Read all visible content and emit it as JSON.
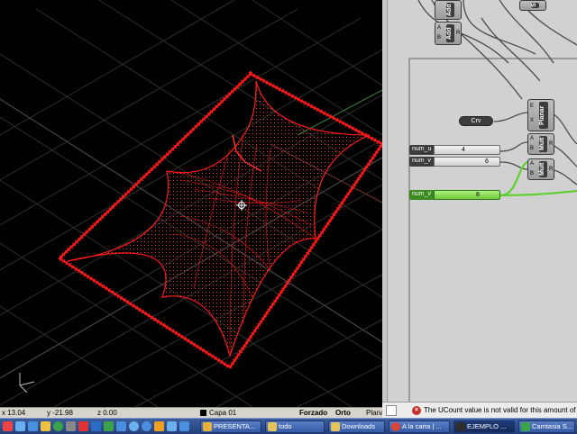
{
  "statusbar": {
    "x": "x 13.04",
    "y": "y -21.98",
    "z": "z 0.00",
    "layer": "Capa 01",
    "snap": "Forzado",
    "ortho": "Orto",
    "planar": "Planar"
  },
  "grasshopper": {
    "nodes": {
      "add_top": "Add",
      "add_mid": "Add",
      "s_top": "S",
      "planar": "Planar",
      "mult_1": "Mult",
      "mult_2": "Mult"
    },
    "ports": {
      "a": "A",
      "b": "B",
      "r": "R",
      "e": "E",
      "x": "X",
      "y": "Y"
    },
    "crv_label": "Crv",
    "sliders": [
      {
        "name": "num_u",
        "value": "4"
      },
      {
        "name": "num_v",
        "value": "6"
      },
      {
        "name": "num_v",
        "value": "8"
      }
    ],
    "message": "The UCount value is not valid for this amount of po"
  },
  "taskbar": {
    "items": [
      {
        "label": "PRESENTA...",
        "color": "#e6b33a"
      },
      {
        "label": "todo",
        "color": "#e6c45a"
      },
      {
        "label": "Downloads",
        "color": "#e6c45a"
      },
      {
        "label": "A la carta | ...",
        "color": "#dd4433"
      },
      {
        "label": "EJEMPLO ...",
        "color": "#2d2d2d"
      },
      {
        "label": "Camtasia S...",
        "color": "#3aa24a"
      }
    ]
  },
  "colors": {
    "mesh": "#ff1a1a",
    "grid": "#3a3a3a",
    "gh_bg": "#d1d1d1",
    "taskbar": "#2c4a88"
  }
}
